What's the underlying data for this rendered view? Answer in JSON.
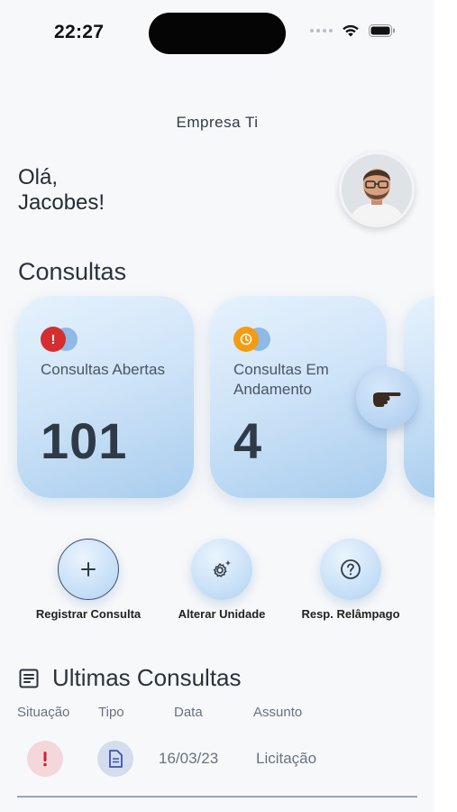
{
  "status_bar": {
    "time": "22:27"
  },
  "header": {
    "company": "Empresa Ti",
    "greeting_line1": "Olá,",
    "greeting_line2": "Jacobes!"
  },
  "consultas": {
    "title": "Consultas",
    "cards": [
      {
        "label": "Consultas Abertas",
        "value": "101",
        "icon": "alert-icon",
        "icon_color": "#d32f2f"
      },
      {
        "label": "Consultas Em Andamento",
        "value": "4",
        "icon": "clock-icon",
        "icon_color": "#f39c12"
      }
    ]
  },
  "actions": [
    {
      "label": "Registrar Consulta",
      "icon": "plus-icon"
    },
    {
      "label": "Alterar Unidade",
      "icon": "settings-sparkle-icon"
    },
    {
      "label": "Resp. Relâmpago",
      "icon": "help-icon"
    }
  ],
  "ultimas": {
    "title": "Ultimas Consultas",
    "columns": [
      "Situação",
      "Tipo",
      "Data",
      "Assunto"
    ],
    "rows": [
      {
        "situacao_icon": "alert-icon",
        "tipo_icon": "document-icon",
        "data": "16/03/23",
        "assunto": "Licitação"
      }
    ]
  },
  "colors": {
    "accent": "#a9cdee",
    "alert": "#d32f2f",
    "warning": "#f39c12",
    "document": "#3f51b5"
  }
}
